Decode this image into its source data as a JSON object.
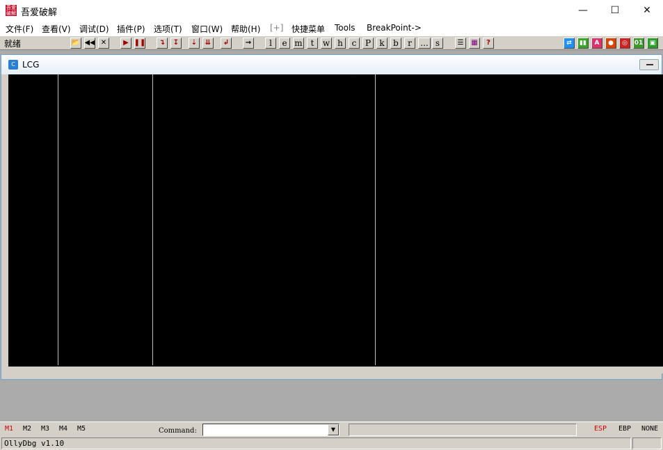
{
  "window": {
    "title": "吾爱破解",
    "icon_text": "吾爱破解",
    "minimize_glyph": "—",
    "maximize_glyph": "☐",
    "close_glyph": "✕"
  },
  "menu": [
    {
      "label": "文件(F)"
    },
    {
      "label": "查看(V)"
    },
    {
      "label": "调试(D)"
    },
    {
      "label": "插件(P)"
    },
    {
      "label": "选项(T)"
    },
    {
      "label": "窗口(W)"
    },
    {
      "label": "帮助(H)"
    },
    {
      "label": "[+]"
    },
    {
      "label": "快捷菜单"
    },
    {
      "label": "Tools"
    },
    {
      "label": "BreakPoint->"
    }
  ],
  "toolbar": {
    "status": "就绪",
    "buttons": [
      {
        "icon": "open-folder-icon",
        "glyph": "📂"
      },
      {
        "icon": "rewind-icon",
        "glyph": "◀◀"
      },
      {
        "icon": "close-icon",
        "glyph": "✕"
      },
      {
        "icon": "run-icon",
        "glyph": "▶"
      },
      {
        "icon": "pause-icon",
        "glyph": "❚❚"
      },
      {
        "icon": "step-into-icon",
        "glyph": "↴"
      },
      {
        "icon": "step-over-icon",
        "glyph": "↧"
      },
      {
        "icon": "trace-into-icon",
        "glyph": "⇣"
      },
      {
        "icon": "trace-over-icon",
        "glyph": "⇊"
      },
      {
        "icon": "execute-till-return-icon",
        "glyph": "↲"
      },
      {
        "icon": "go-to-icon",
        "glyph": "→"
      }
    ],
    "letters": [
      "l",
      "e",
      "m",
      "t",
      "w",
      "h",
      "c",
      "P",
      "k",
      "b",
      "r",
      "...",
      "s"
    ],
    "extra_buttons": [
      {
        "icon": "list-icon",
        "glyph": "☰"
      },
      {
        "icon": "grid-icon",
        "glyph": "▦"
      },
      {
        "icon": "help-icon",
        "glyph": "?"
      }
    ],
    "plugin_buttons": [
      {
        "icon": "refresh-icon",
        "glyph": "⇄",
        "color": "#1e90ff"
      },
      {
        "icon": "plugin-green-icon",
        "glyph": "▮▮",
        "color": "#33aa22"
      },
      {
        "icon": "plugin-a-icon",
        "glyph": "A",
        "color": "#e0306a"
      },
      {
        "icon": "record-icon",
        "glyph": "●",
        "color": "#e04000"
      },
      {
        "icon": "target-icon",
        "glyph": "◎",
        "color": "#d02020"
      },
      {
        "icon": "binary-icon",
        "glyph": "01",
        "color": "#3a9a2a"
      },
      {
        "icon": "chip-icon",
        "glyph": "▣",
        "color": "#2aa02a"
      }
    ]
  },
  "child_window": {
    "title": "LCG",
    "icon_text": "C"
  },
  "bottom": {
    "memory_tabs": [
      {
        "label": "M1",
        "active": true
      },
      {
        "label": "M2",
        "active": false
      },
      {
        "label": "M3",
        "active": false
      },
      {
        "label": "M4",
        "active": false
      },
      {
        "label": "M5",
        "active": false
      }
    ],
    "command_label": "Command:",
    "command_value": "",
    "dropdown_glyph": "▼",
    "registers": [
      {
        "label": "ESP",
        "active": true
      },
      {
        "label": "EBP",
        "active": false
      },
      {
        "label": "NONE",
        "active": false
      }
    ]
  },
  "status_bar": {
    "text": "OllyDbg v1.10"
  },
  "colors": {
    "pane_background": "#000000",
    "toolbar_background": "#d4d0c8",
    "active_red": "#d00000"
  }
}
